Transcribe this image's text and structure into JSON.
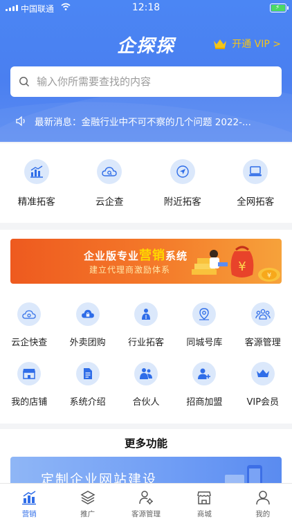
{
  "status_bar": {
    "carrier": "中国联通",
    "time": "12:18",
    "battery_color": "#4cd964"
  },
  "header": {
    "logo_text": "企探探",
    "vip_label": "开通 VIP >",
    "accent": "#4a7ff0",
    "vip_color": "#f5c518"
  },
  "search": {
    "placeholder": "输入你所需要查找的内容",
    "value": ""
  },
  "news": {
    "text": "最新消息：金融行业中不可不察的几个问题  2022-..."
  },
  "quick_tiles": [
    {
      "label": "精准拓客",
      "icon": "bar-chart-icon"
    },
    {
      "label": "云企查",
      "icon": "cloud-search-icon"
    },
    {
      "label": "附近拓客",
      "icon": "location-arrow-icon"
    },
    {
      "label": "全网拓客",
      "icon": "monitor-icon"
    }
  ],
  "banner": {
    "line1_prefix": "企业版专业",
    "line1_highlight": "营销",
    "line1_suffix": "系统",
    "line2": "建立代理商激励体系"
  },
  "features": [
    {
      "label": "云企快查",
      "icon": "cloud-search-icon"
    },
    {
      "label": "外卖团购",
      "icon": "cloud-lock-icon"
    },
    {
      "label": "行业拓客",
      "icon": "people-icon"
    },
    {
      "label": "同城号库",
      "icon": "map-pin-icon"
    },
    {
      "label": "客源管理",
      "icon": "group-icon"
    },
    {
      "label": "我的店铺",
      "icon": "store-icon"
    },
    {
      "label": "系统介绍",
      "icon": "document-icon"
    },
    {
      "label": "合伙人",
      "icon": "partners-icon"
    },
    {
      "label": "招商加盟",
      "icon": "add-user-icon"
    },
    {
      "label": "VIP会员",
      "icon": "crown-icon"
    }
  ],
  "more": {
    "title": "更多功能",
    "promo_text": "定制企业网站建设"
  },
  "tabbar": [
    {
      "label": "营销",
      "icon": "chart-icon",
      "active": true
    },
    {
      "label": "推广",
      "icon": "layers-icon",
      "active": false
    },
    {
      "label": "客源管理",
      "icon": "user-gear-icon",
      "active": false
    },
    {
      "label": "商城",
      "icon": "shop-icon",
      "active": false
    },
    {
      "label": "我的",
      "icon": "person-icon",
      "active": false
    }
  ],
  "colors": {
    "icon_blue": "#2f6de8",
    "icon_bg": "#dbe8fb",
    "banner_orange": "#ee5a1f"
  }
}
